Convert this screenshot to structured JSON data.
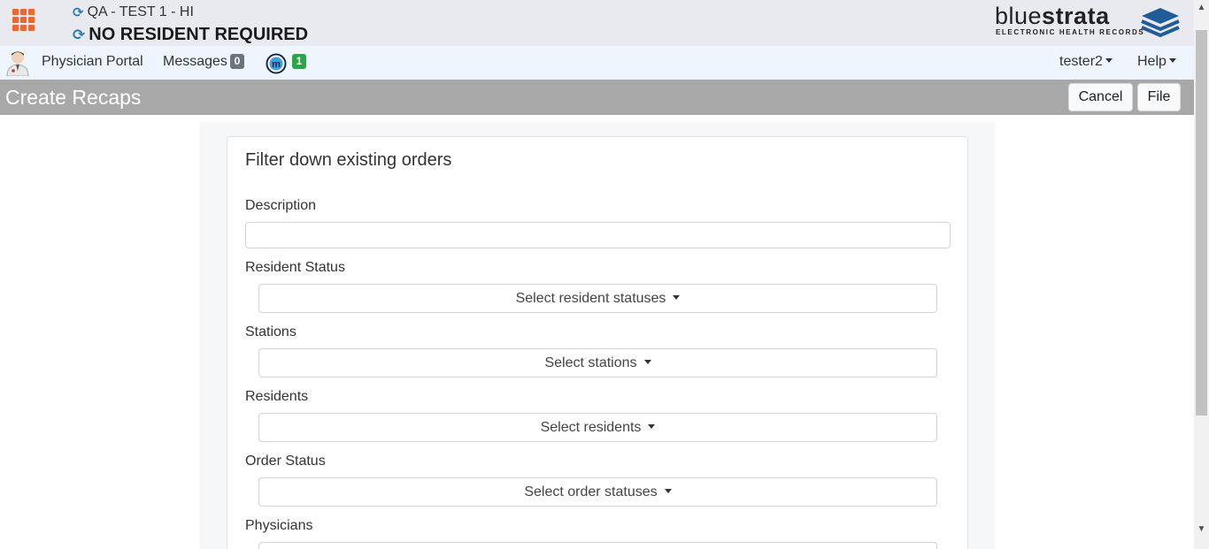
{
  "header": {
    "environment": "QA - TEST 1 - HI",
    "resident": "NO RESIDENT REQUIRED",
    "logo": {
      "word_light": "blue",
      "word_bold": "strata",
      "subtitle": "ELECTRONIC HEALTH RECORDS"
    },
    "colors": {
      "grid": "#f2662d",
      "sync": "#2a7ab8",
      "logo_blue": "#1f5c99"
    }
  },
  "nav": {
    "portal": "Physician Portal",
    "messages_label": "Messages",
    "messages_count": "0",
    "m_count": "1",
    "user": "tester2",
    "help": "Help"
  },
  "titlebar": {
    "title": "Create Recaps",
    "cancel": "Cancel",
    "file": "File"
  },
  "form": {
    "heading": "Filter down existing orders",
    "description_label": "Description",
    "description_value": "",
    "resident_status_label": "Resident Status",
    "resident_status_select": "Select resident statuses",
    "stations_label": "Stations",
    "stations_select": "Select stations",
    "residents_label": "Residents",
    "residents_select": "Select residents",
    "order_status_label": "Order Status",
    "order_status_select": "Select order statuses",
    "physicians_label": "Physicians"
  }
}
